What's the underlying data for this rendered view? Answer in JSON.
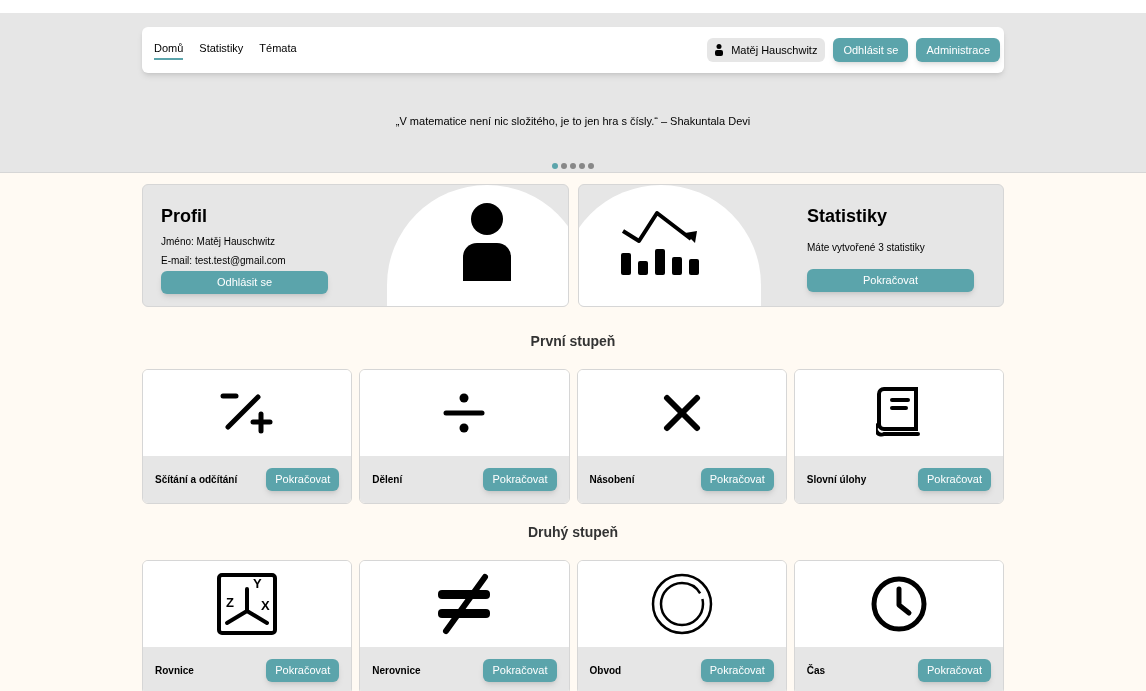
{
  "nav": {
    "tabs": [
      {
        "label": "Domů",
        "selected": true
      },
      {
        "label": "Statistiky",
        "selected": false
      },
      {
        "label": "Témata",
        "selected": false
      }
    ],
    "user": "Matěj Hauschwitz",
    "buttons": [
      "Odhlásit se",
      "Administrace"
    ]
  },
  "quote": {
    "text": "„V matematice není nic složitého, je to jen hra s čísly.“ – Shakuntala Devi",
    "dots": [
      {
        "selected": true
      },
      {
        "selected": false
      },
      {
        "selected": false
      },
      {
        "selected": false
      },
      {
        "selected": false
      }
    ]
  },
  "profile": {
    "title": "Profil",
    "lines": [
      "Jméno: Matěj Hauschwitz",
      "E-mail: test.test@gmail.com"
    ],
    "button": "Odhlásit se"
  },
  "stats": {
    "title": "Statistiky",
    "text": "Máte vytvořené 3 statistiky",
    "button": "Pokračovat"
  },
  "sections": [
    {
      "title": "První stupeň",
      "topics": [
        {
          "label": "Sčítání a odčítání",
          "kind": "plusminus",
          "button": "Pokračovat"
        },
        {
          "label": "Dělení",
          "kind": "divide",
          "button": "Pokračovat"
        },
        {
          "label": "Násobení",
          "kind": "times",
          "button": "Pokračovat"
        },
        {
          "label": "Slovní úlohy",
          "kind": "book",
          "button": "Pokračovat"
        }
      ]
    },
    {
      "title": "Druhý stupeň",
      "topics": [
        {
          "label": "Rovnice",
          "kind": "axes",
          "axis_labels": [
            "Y",
            "Z",
            "X"
          ],
          "button": "Pokračovat"
        },
        {
          "label": "Nerovnice",
          "kind": "notequal",
          "button": "Pokračovat"
        },
        {
          "label": "Obvod",
          "kind": "circle",
          "button": "Pokračovat"
        },
        {
          "label": "Čas",
          "kind": "clock",
          "button": "Pokračovat"
        }
      ]
    }
  ]
}
